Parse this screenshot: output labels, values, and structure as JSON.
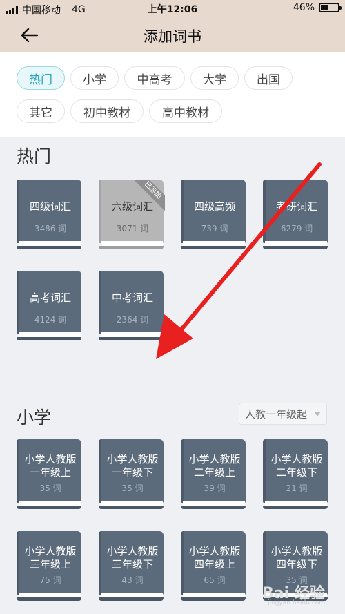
{
  "status": {
    "carrier": "中国移动",
    "network": "4G",
    "time": "上午12:06",
    "battery": "46%",
    "battery_level": 0.46
  },
  "nav": {
    "title": "添加词书"
  },
  "filters": [
    {
      "label": "热门",
      "active": true
    },
    {
      "label": "小学",
      "active": false
    },
    {
      "label": "中高考",
      "active": false
    },
    {
      "label": "大学",
      "active": false
    },
    {
      "label": "出国",
      "active": false
    },
    {
      "label": "其它",
      "active": false
    },
    {
      "label": "初中教材",
      "active": false
    },
    {
      "label": "高中教材",
      "active": false
    }
  ],
  "hot": {
    "title": "热门",
    "books": [
      {
        "name": "四级词汇",
        "count": "3486 词"
      },
      {
        "name": "六级词汇",
        "count": "3071 词",
        "added_label": "已添加"
      },
      {
        "name": "四级高频",
        "count": "739 词"
      },
      {
        "name": "考研词汇",
        "count": "6279 词"
      },
      {
        "name": "高考词汇",
        "count": "4124 词"
      },
      {
        "name": "中考词汇",
        "count": "2364 词"
      }
    ]
  },
  "primary": {
    "title": "小学",
    "select_value": "人教一年级起",
    "books": [
      {
        "name": "小学人教版\n一年级上",
        "count": "35 词"
      },
      {
        "name": "小学人教版\n一年级下",
        "count": "35 词"
      },
      {
        "name": "小学人教版\n二年级上",
        "count": "39 词"
      },
      {
        "name": "小学人教版\n二年级下",
        "count": "21 词"
      },
      {
        "name": "小学人教版\n三年级上",
        "count": "75 词"
      },
      {
        "name": "小学人教版\n三年级下",
        "count": "43 词"
      },
      {
        "name": "小学人教版\n四年级上",
        "count": "65 词"
      },
      {
        "name": "小学人教版\n四年级下",
        "count": "35 词"
      }
    ]
  },
  "watermark": {
    "text": "Bai 经验",
    "sub": "jingyan.baidu.com"
  }
}
